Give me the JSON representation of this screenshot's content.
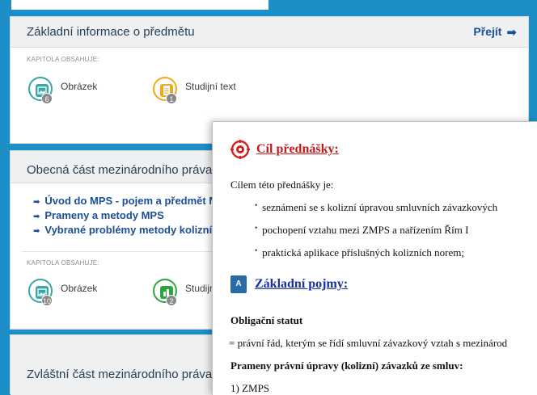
{
  "panel1": {
    "title": "Základní informace o předmětu",
    "go_label": "Přejít",
    "chapter_label": "Kapitola obsahuje:",
    "chips": [
      {
        "label": "Obrázek",
        "count": "6",
        "icon": "image-icon",
        "color": "#3aa6a8"
      },
      {
        "label": "Studijní text",
        "count": "1",
        "icon": "document-icon",
        "color": "#f2a81d"
      }
    ]
  },
  "panel2": {
    "title": "Obecná část mezinárodního práva so",
    "links": [
      "Úvod do MPS - pojem a předmět MPS",
      "Prameny a metody MPS",
      "Vybrané problémy metody kolizní"
    ],
    "chapter_label": "Kapitola obsahuje:",
    "chips": [
      {
        "label": "Obrázek",
        "count": "10",
        "icon": "image-icon",
        "color": "#3aa6a8"
      },
      {
        "label": "Studijn",
        "count": "2",
        "icon": "chart-icon",
        "color": "#2aa640"
      }
    ]
  },
  "panel3": {
    "title": "Zvláštní část mezinárodního práva so"
  },
  "doc": {
    "heading1": "Cíl přednášky:",
    "intro": "Cílem této přednášky je:",
    "bullets": [
      "seznámení se s kolizní úpravou smluvních závazkových",
      "pochopení vztahu mezi ZMPS a nařízením Řím I",
      "praktická aplikace příslušných kolizních norem;"
    ],
    "heading2": "Základní pojmy:",
    "book_icon_text": "A",
    "term1": "Obligační statut",
    "term1_def": "= právní řád, kterým se řídí smluvní závazkový vztah s mezinárod",
    "term2": "Prameny právní úpravy (kolizní) závazků ze smluv:",
    "item1": "1) ZMPS"
  },
  "colors": {
    "background": "#1d8fc6",
    "link": "#1c4e96",
    "heading_red": "#c41a1a",
    "heading_blue": "#1a2fa0"
  }
}
